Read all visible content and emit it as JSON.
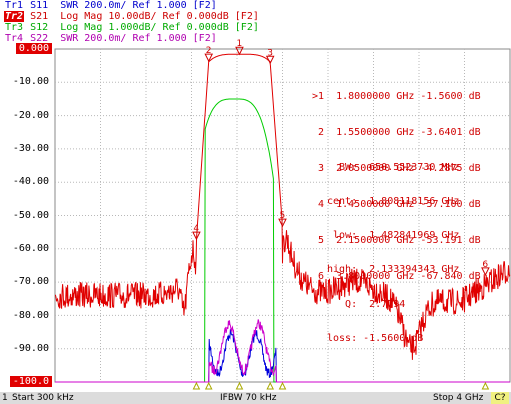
{
  "traces": [
    {
      "id": "Tr1",
      "text": "S11  SWR 200.0m/ Ref 1.000 [F2]",
      "color": "#0000cc",
      "active": false
    },
    {
      "id": "Tr2",
      "text": "S21  Log Mag 10.00dB/ Ref 0.000dB [F2]",
      "color": "#cc0000",
      "active": true
    },
    {
      "id": "Tr3",
      "text": "S12  Log Mag 1.000dB/ Ref 0.000dB [F2]",
      "color": "#00aa00",
      "active": false
    },
    {
      "id": "Tr4",
      "text": "S22  SWR 200.0m/ Ref 1.000 [F2]",
      "color": "#b000b0",
      "active": false
    }
  ],
  "y_axis": {
    "labels": [
      "0.000",
      "-10.00",
      "-20.00",
      "-30.00",
      "-40.00",
      "-50.00",
      "-60.00",
      "-70.00",
      "-80.00",
      "-90.00",
      "-100.0"
    ],
    "highlighted": [
      "0.000",
      "-100.0"
    ],
    "ref_marker": "▶"
  },
  "chart_data": {
    "type": "line",
    "xlabel": "",
    "ylabel": "",
    "x_range_ghz": [
      0.3,
      4.0
    ],
    "ylim": [
      -100,
      0
    ],
    "grid": true,
    "series": [
      {
        "name": "S21",
        "color": "#e00000"
      },
      {
        "name": "S12",
        "color": "#00cc00"
      },
      {
        "name": "S11",
        "color": "#0000dd"
      },
      {
        "name": "S22",
        "color": "#cc00cc"
      }
    ]
  },
  "marker_table": {
    "rows": [
      {
        "n": ">1",
        "freq": "1.8000000 GHz",
        "val": "-1.5600 dB"
      },
      {
        "n": "2",
        "freq": "1.5500000 GHz",
        "val": "-3.6401 dB"
      },
      {
        "n": "3",
        "freq": "2.0500000 GHz",
        "val": "-4.2875 dB"
      },
      {
        "n": "4",
        "freq": "1.4500000 GHz",
        "val": "-57.100 dB"
      },
      {
        "n": "5",
        "freq": "2.1500000 GHz",
        "val": "-53.191 dB"
      },
      {
        "n": "6",
        "freq": "3.8000000 GHz",
        "val": "-67.840 dB"
      }
    ]
  },
  "bw_stats": {
    "lines": [
      "  BW:  650.5523730 MHz",
      "cent:  1.808118156 GHz",
      " low:  1.482841969 GHz",
      "high:  2.133394343 GHz",
      "   Q:  2.7794",
      "loss: -1.5600 dB"
    ]
  },
  "footer": {
    "channel": "1",
    "start": "Start 300 kHz",
    "ifbw": "IFBW 70 kHz",
    "stop": "Stop 4 GHz",
    "badge": "C?"
  }
}
